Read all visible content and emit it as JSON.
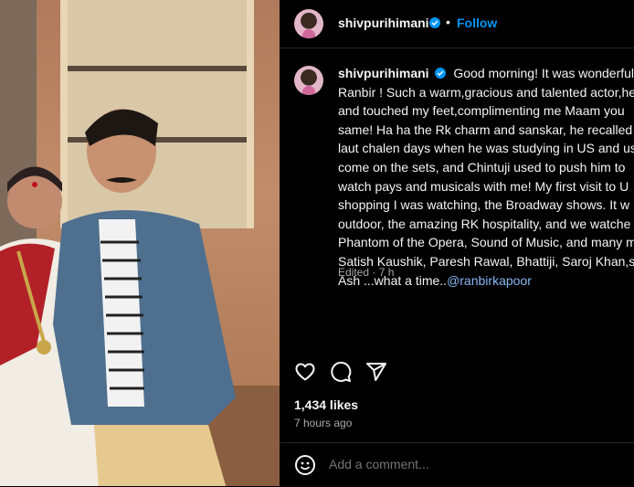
{
  "post": {
    "username": "shivpurihimani",
    "follow_label": "Follow",
    "separator": "•",
    "caption_lines": [
      "Good morning! It was wonderful m",
      "Ranbir ! Such a warm,gracious and talented actor,he",
      "and touched my feet,complimenting me Maam you",
      "same! Ha ha the Rk charm and sanskar, he recalled",
      "laut chalen days when he was studying in US and us",
      "come on the sets, and Chintuji used to push him to",
      "watch pays and musicals with me! My first visit to U",
      "shopping I was watching, the Broadway shows. It w",
      "outdoor, the amazing RK hospitality, and we watche",
      "Phantom of the Opera, Sound of Music, and many m",
      "Satish Kaushik, Paresh Rawal, Bhattiji, Saroj Khan,so",
      "Ash ...what a time.."
    ],
    "mention": "@ranbirkapoor",
    "edited_label": "Edited · 7 h",
    "likes": "1,434 likes",
    "time_ago": "7 hours ago",
    "comment_placeholder": "Add a comment..."
  },
  "icons": {
    "like": "heart-icon",
    "comment": "comment-icon",
    "share": "share-icon",
    "emoji": "emoji-icon",
    "verified": "verified-badge-icon"
  },
  "colors": {
    "background": "#000000",
    "link": "#0095f6",
    "verified": "#0095f6",
    "muted": "#a8a8a8"
  }
}
